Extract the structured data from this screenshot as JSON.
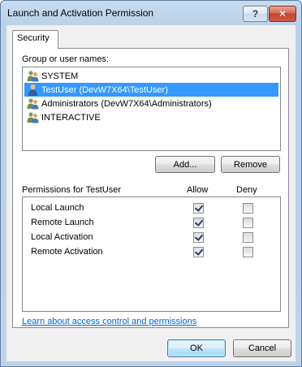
{
  "window": {
    "title": "Launch and Activation Permission",
    "help_symbol": "?",
    "close_symbol": "✕"
  },
  "tab": {
    "label": "Security"
  },
  "users": {
    "label": "Group or user names:",
    "items": [
      {
        "name": "SYSTEM",
        "icon": "group-icon",
        "selected": false
      },
      {
        "name": "TestUser (DevW7X64\\TestUser)",
        "icon": "user-icon",
        "selected": true
      },
      {
        "name": "Administrators (DevW7X64\\Administrators)",
        "icon": "group-icon",
        "selected": false
      },
      {
        "name": "INTERACTIVE",
        "icon": "group-icon",
        "selected": false
      }
    ]
  },
  "buttons": {
    "add": "Add...",
    "remove": "Remove",
    "ok": "OK",
    "cancel": "Cancel"
  },
  "permissions": {
    "header": "Permissions for TestUser",
    "allow_label": "Allow",
    "deny_label": "Deny",
    "rows": [
      {
        "name": "Local Launch",
        "allow": true,
        "deny": false
      },
      {
        "name": "Remote Launch",
        "allow": true,
        "deny": false
      },
      {
        "name": "Local Activation",
        "allow": true,
        "deny": false
      },
      {
        "name": "Remote Activation",
        "allow": true,
        "deny": false
      }
    ]
  },
  "link": {
    "text": "Learn about access control and permissions"
  },
  "colors": {
    "selection": "#3399ff",
    "link": "#0066cc"
  }
}
